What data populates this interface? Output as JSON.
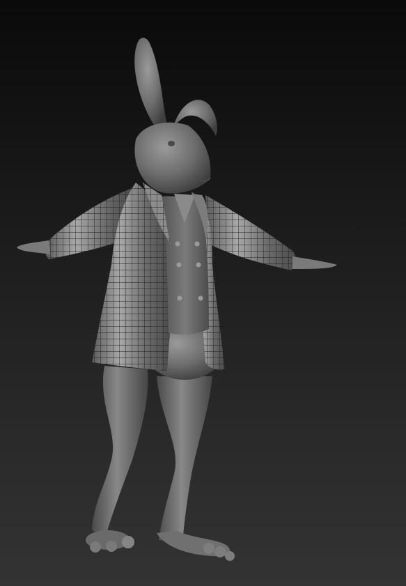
{
  "viewport": {
    "background_top": "#0a0a0a",
    "background_bottom": "#333333"
  },
  "model": {
    "subject": "rabbit-character-sculpt",
    "base_color": "#6e6e6e",
    "wireframe_color": "#1e1e1e",
    "pose": "t-pose"
  }
}
